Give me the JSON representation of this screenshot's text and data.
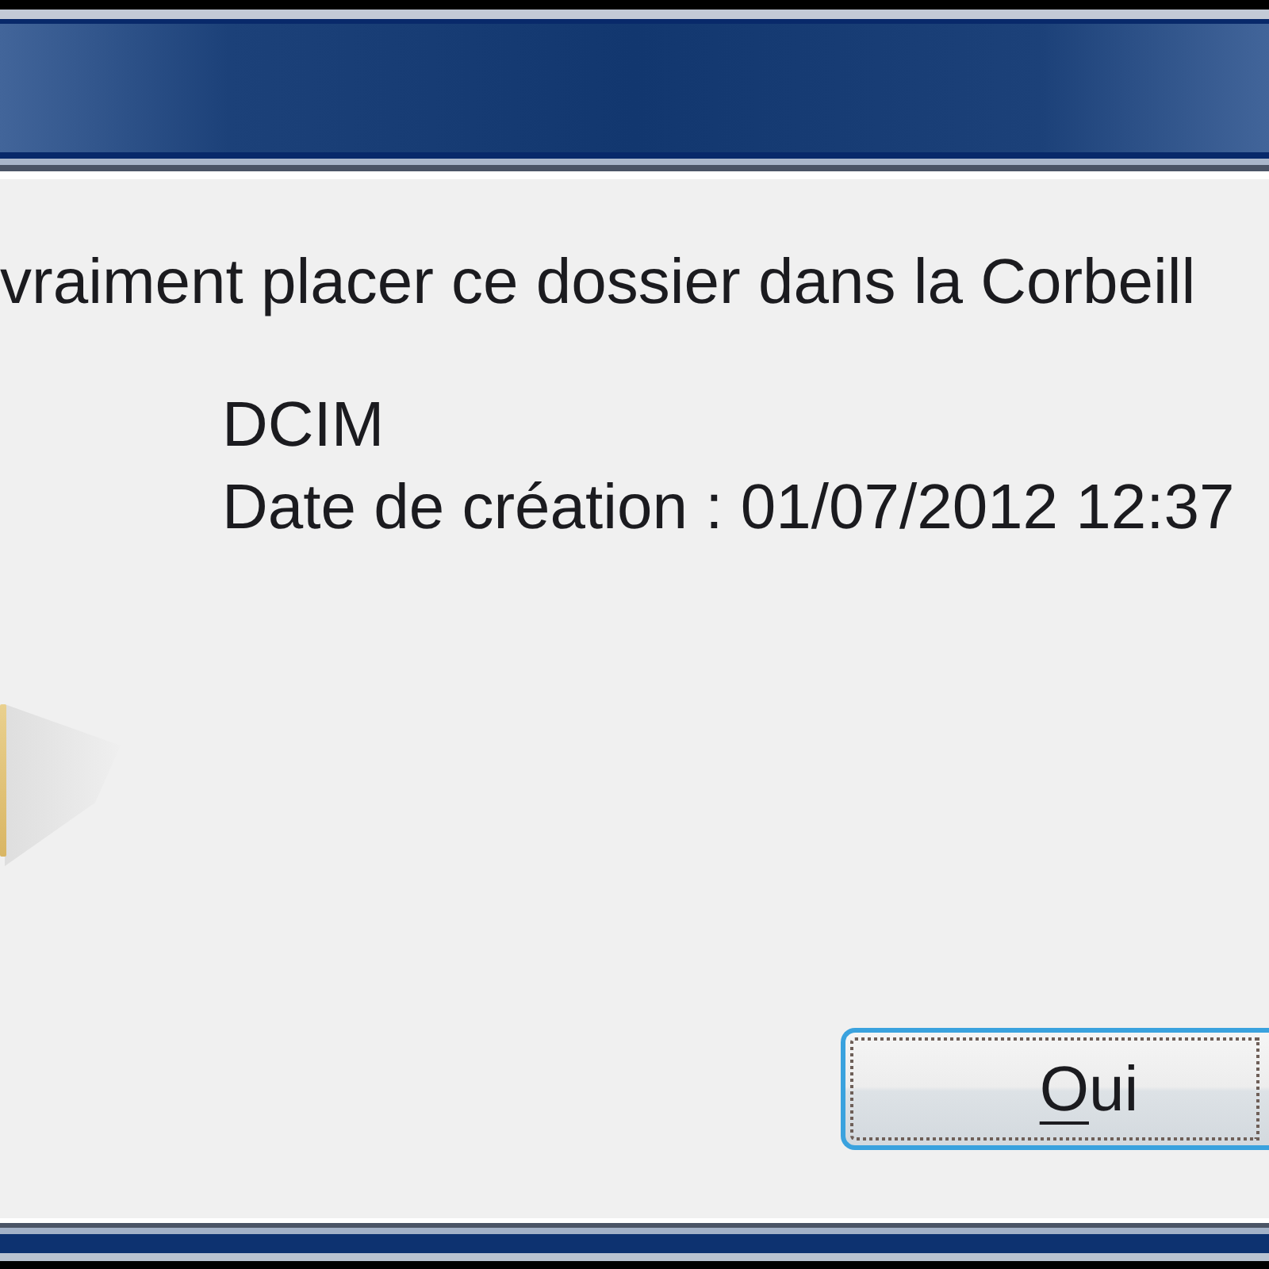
{
  "window": {
    "active": true
  },
  "message": "vraiment placer ce dossier dans la Corbeill",
  "item": {
    "name": "DCIM",
    "details": [
      "Date de création : 01/07/2012 12:37"
    ]
  },
  "buttons": [
    {
      "access_key": "O",
      "label_rest": "ui",
      "focused": true
    }
  ]
}
